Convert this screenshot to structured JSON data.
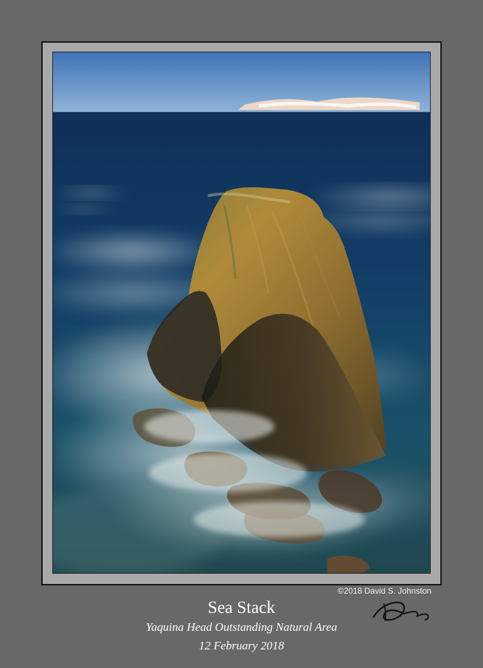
{
  "photo": {
    "subject": "sea-stack-photo"
  },
  "caption": {
    "copyright": "©2018 David S. Johnston",
    "title": "Sea Stack",
    "subtitle": "Yaquina Head Outstanding Natural Area",
    "date": "12 February 2018"
  },
  "signature": {
    "icon": "signature-icon"
  }
}
